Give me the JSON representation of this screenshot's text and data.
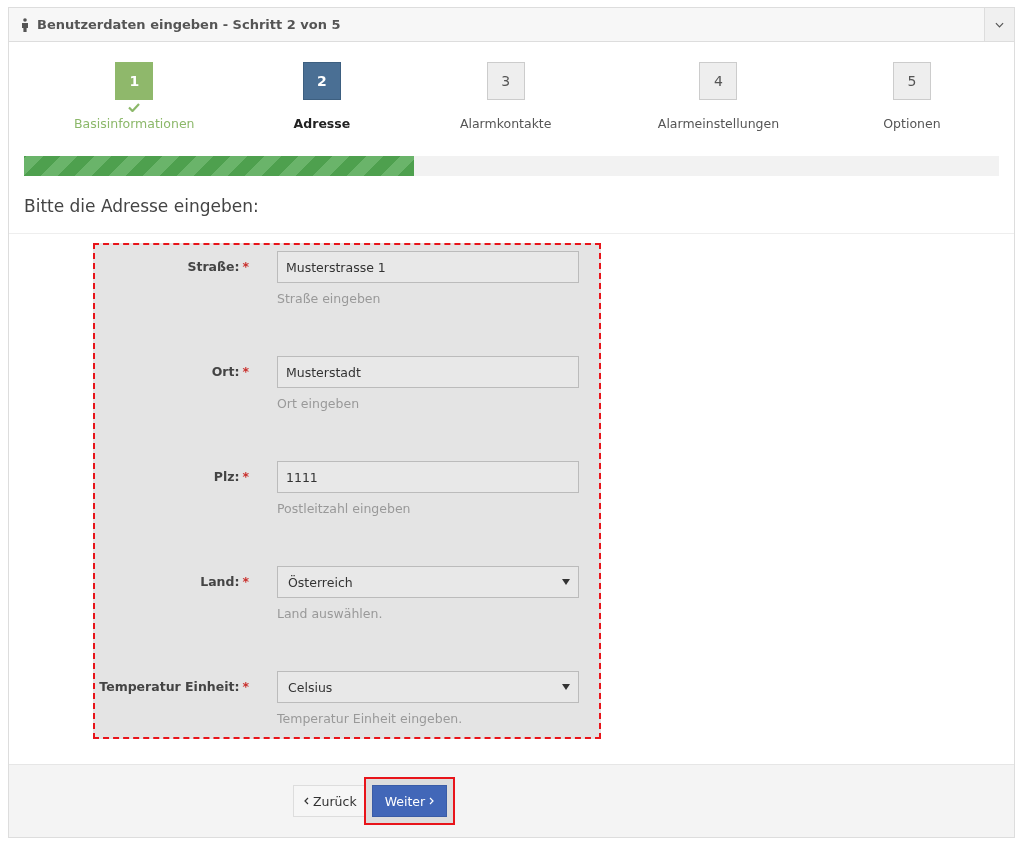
{
  "panel": {
    "title": "Benutzerdaten eingeben - Schritt 2 von 5",
    "collapse_expanded": true
  },
  "steps": [
    {
      "number": "1",
      "label": "Basisinformationen",
      "completed": true,
      "selected": false
    },
    {
      "number": "2",
      "label": "Adresse",
      "completed": false,
      "selected": true
    },
    {
      "number": "3",
      "label": "Alarmkontakte",
      "completed": false,
      "selected": false
    },
    {
      "number": "4",
      "label": "Alarmeinstellungen",
      "completed": false,
      "selected": false
    },
    {
      "number": "5",
      "label": "Optionen",
      "completed": false,
      "selected": false
    }
  ],
  "progress": {
    "level": 0.4
  },
  "heading": "Bitte die Adresse eingeben:",
  "form": {
    "highlighted": true,
    "fields": [
      {
        "kind": "text",
        "label": "Straße:",
        "required_mark": "*",
        "value": "Musterstrasse 1",
        "help": "Straße eingeben"
      },
      {
        "kind": "text",
        "label": "Ort:",
        "required_mark": "*",
        "value": "Musterstadt",
        "help": "Ort eingeben"
      },
      {
        "kind": "text",
        "label": "Plz:",
        "required_mark": "*",
        "value": "1111",
        "help": "Postleitzahl eingeben"
      },
      {
        "kind": "select",
        "label": "Land:",
        "required_mark": "*",
        "value": "Österreich",
        "help": "Land auswählen."
      },
      {
        "kind": "select",
        "label": "Temperatur Einheit:",
        "required_mark": "*",
        "value": "Celsius",
        "help": "Temperatur Einheit eingeben."
      }
    ]
  },
  "buttons": [
    {
      "kind": "back",
      "label": "Zurück",
      "highlighted": false
    },
    {
      "kind": "next",
      "label": "Weiter",
      "highlighted": true
    }
  ]
}
